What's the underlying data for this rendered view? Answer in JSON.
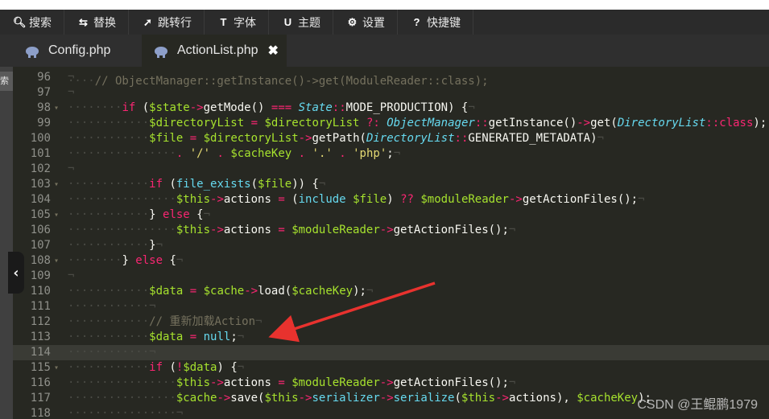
{
  "toolbar": {
    "items": [
      {
        "icon": "search-icon",
        "glyph": "🔍︎",
        "label": "搜索"
      },
      {
        "icon": "replace-icon",
        "glyph": "⇆",
        "label": "替换"
      },
      {
        "icon": "goto-line-icon",
        "glyph": "➚",
        "label": "跳转行"
      },
      {
        "icon": "font-icon",
        "glyph": "T",
        "label": "字体"
      },
      {
        "icon": "theme-icon",
        "glyph": "U",
        "label": "主题"
      },
      {
        "icon": "gear-icon",
        "glyph": "⚙",
        "label": "设置"
      },
      {
        "icon": "help-icon",
        "glyph": "?",
        "label": "快捷键"
      }
    ]
  },
  "tabs": [
    {
      "label": "Config.php",
      "active": false
    },
    {
      "label": "ActionList.php",
      "active": true,
      "close": "✖"
    }
  ],
  "sidebar": {
    "label": "索"
  },
  "collapse_glyph": "‹",
  "current_line": 114,
  "code_lines": [
    {
      "n": "96",
      "html": "<span class='ws'>¬</span>"
    },
    {
      "n": "97",
      "html": "<span class='ws'>¬</span>"
    },
    {
      "n": "98",
      "html": "<span class='ws'>········</span><span class='kw'>if</span> (<span class='var'>$state</span><span class='op'>-></span>getMode() <span class='op'>===</span> <span class='cls'>State</span><span class='op'>::</span>MODE_PRODUCTION) {<span class='ws'>¬</span>"
    },
    {
      "n": "99",
      "html": "<span class='ws'>············</span><span class='var'>$directoryList</span> <span class='op'>=</span> <span class='var'>$directoryList</span> <span class='op'>?:</span> <span class='cls'>ObjectManager</span><span class='op'>::</span>getInstance()<span class='op'>-></span>get(<span class='cls'>DirectoryList</span><span class='op'>::</span><span class='kw'>class</span>);"
    },
    {
      "n": "100",
      "html": "<span class='ws'>············</span><span class='var'>$file</span> <span class='op'>=</span> <span class='var'>$directoryList</span><span class='op'>-></span>getPath(<span class='cls'>DirectoryList</span><span class='op'>::</span>GENERATED_METADATA)<span class='ws'>¬</span>"
    },
    {
      "n": "101",
      "html": "<span class='ws'>················</span><span class='op'>.</span> <span class='str'>'/'</span> <span class='op'>.</span> <span class='var'>$cacheKey</span> <span class='op'>.</span> <span class='str'>'.'</span> <span class='op'>.</span> <span class='str'>'php'</span>;<span class='ws'>¬</span>"
    },
    {
      "n": "102",
      "html": "<span class='ws'>¬</span>"
    },
    {
      "n": "103",
      "html": "<span class='ws'>············</span><span class='kw'>if</span> (<span class='bi'>file_exists</span>(<span class='var'>$file</span>)) {<span class='ws'>¬</span>"
    },
    {
      "n": "104",
      "html": "<span class='ws'>················</span><span class='var'>$this</span><span class='op'>-></span>actions <span class='op'>=</span> (<span class='bi'>include</span> <span class='var'>$file</span>) <span class='op'>??</span> <span class='var'>$moduleReader</span><span class='op'>-></span>getActionFiles();<span class='ws'>¬</span>"
    },
    {
      "n": "105",
      "html": "<span class='ws'>············</span>} <span class='kw'>else</span> {<span class='ws'>¬</span>"
    },
    {
      "n": "106",
      "html": "<span class='ws'>················</span><span class='var'>$this</span><span class='op'>-></span>actions <span class='op'>=</span> <span class='var'>$moduleReader</span><span class='op'>-></span>getActionFiles();<span class='ws'>¬</span>"
    },
    {
      "n": "107",
      "html": "<span class='ws'>············</span>}<span class='ws'>¬</span>"
    },
    {
      "n": "108",
      "html": "<span class='ws'>········</span>} <span class='kw'>else</span> {<span class='ws'>¬</span>"
    },
    {
      "n": "109",
      "html": "<span class='ws'>¬</span>"
    },
    {
      "n": "110",
      "html": "<span class='ws'>············</span><span class='var'>$data</span> <span class='op'>=</span> <span class='var'>$cache</span><span class='op'>-></span>load(<span class='var'>$cacheKey</span>);<span class='ws'>¬</span>"
    },
    {
      "n": "111",
      "html": "<span class='ws'>············¬</span>"
    },
    {
      "n": "112",
      "html": "<span class='ws'>············</span><span class='cm'>// 重新加载Action</span><span class='ws'>¬</span>"
    },
    {
      "n": "113",
      "html": "<span class='ws'>············</span><span class='var'>$data</span> <span class='op'>=</span> <span class='nul'>null</span>;<span class='ws'>¬</span>"
    },
    {
      "n": "114",
      "html": "<span class='ws'>············¬</span>"
    },
    {
      "n": "115",
      "html": "<span class='ws'>············</span><span class='kw'>if</span> (<span class='op'>!</span><span class='var'>$data</span>) {<span class='ws'>¬</span>"
    },
    {
      "n": "116",
      "html": "<span class='ws'>················</span><span class='var'>$this</span><span class='op'>-></span>actions <span class='op'>=</span> <span class='var'>$moduleReader</span><span class='op'>-></span>getActionFiles();<span class='ws'>¬</span>"
    },
    {
      "n": "117",
      "html": "<span class='ws'>················</span><span class='var'>$cache</span><span class='op'>-></span>save(<span class='var'>$this</span><span class='op'>-></span><span class='bi'>serializer</span><span class='op'>-></span><span class='bi'>serialize</span>(<span class='var'>$this</span><span class='op'>-></span>actions), <span class='var'>$cacheKey</span>);"
    },
    {
      "n": "118",
      "html": "<span class='ws'>················¬</span>"
    }
  ],
  "watermark": "CSDN @王鲲鹏1979",
  "colors": {
    "background": "#272822",
    "keyword": "#f92672",
    "variable": "#a6e22e",
    "class": "#66d9ef",
    "string": "#e6db74",
    "comment": "#75715e",
    "arrow": "#e8322e"
  }
}
